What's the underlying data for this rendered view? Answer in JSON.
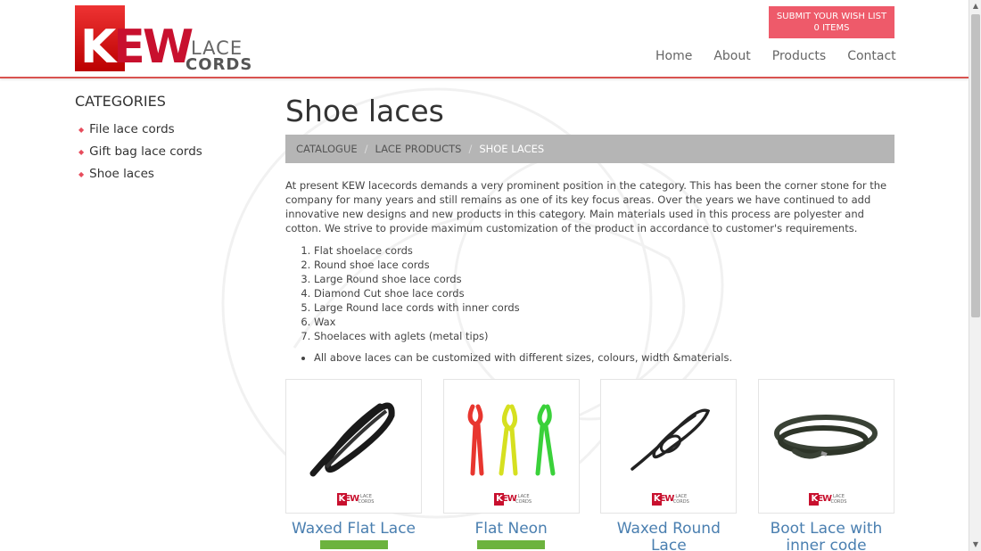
{
  "brand": {
    "logo_main": "KEW",
    "logo_lace": "LACE",
    "logo_cords": "CORDS"
  },
  "wishlist": {
    "line1": "SUBMIT YOUR WISH LIST",
    "line2": "0 ITEMS"
  },
  "nav": {
    "home": "Home",
    "about": "About",
    "products": "Products",
    "contact": "Contact"
  },
  "sidebar": {
    "heading": "CATEGORIES",
    "items": [
      {
        "label": "File lace cords"
      },
      {
        "label": "Gift bag lace cords"
      },
      {
        "label": "Shoe laces"
      }
    ]
  },
  "main": {
    "title": "Shoe laces",
    "breadcrumb": {
      "crumb1": "CATALOGUE",
      "crumb2": "LACE PRODUCTS",
      "current": "SHOE LACES"
    },
    "intro": "At present KEW lacecords demands a very prominent position in the category. This has been the corner stone for the company for many years and still remains as one of its key focus areas. Over the years we have continued to add innovative new designs and new products in this category. Main materials used in this process are polyester and cotton. We strive to provide maximum customization of the product in accordance to customer's requirements.",
    "types": [
      "Flat shoelace cords",
      "Round shoe lace cords",
      "Large Round shoe lace cords",
      "Diamond Cut shoe lace cords",
      "Large Round lace cords with inner cords",
      "Wax",
      "Shoelaces with aglets (metal tips)"
    ],
    "note": "All above laces can be customized with different sizes, colours, width &materials."
  },
  "products": [
    {
      "name_line1": "Waxed Flat Lace",
      "name_line2": "",
      "color": "#1a1a1a"
    },
    {
      "name_line1": "Flat Neon",
      "name_line2": "",
      "color": "#e8362f"
    },
    {
      "name_line1": "Waxed Round",
      "name_line2": "Lace",
      "color": "#222222"
    },
    {
      "name_line1": "Boot Lace with",
      "name_line2": "inner code",
      "color": "#3a4236"
    }
  ],
  "mini_logo": {
    "kew": "KEW",
    "lace": "LACE",
    "cords": "CORDS"
  }
}
